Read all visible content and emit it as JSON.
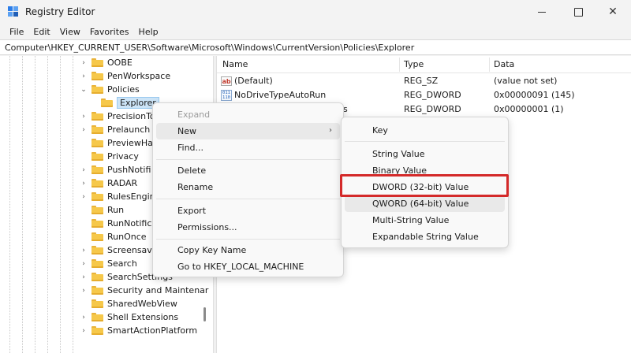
{
  "window": {
    "title": "Registry Editor",
    "controls": {
      "minimize": "minimize",
      "maximize": "maximize",
      "close": "✕"
    }
  },
  "menubar": [
    "File",
    "Edit",
    "View",
    "Favorites",
    "Help"
  ],
  "address": "Computer\\HKEY_CURRENT_USER\\Software\\Microsoft\\Windows\\CurrentVersion\\Policies\\Explorer",
  "tree": [
    {
      "label": "OOBE",
      "chevron": "›"
    },
    {
      "label": "PenWorkspace",
      "chevron": "›"
    },
    {
      "label": "Policies",
      "chevron": "⌄"
    },
    {
      "label": "Explorer",
      "chevron": ""
    },
    {
      "label": "PrecisionTo",
      "chevron": "›"
    },
    {
      "label": "Prelaunch",
      "chevron": "›"
    },
    {
      "label": "PreviewHa",
      "chevron": ""
    },
    {
      "label": "Privacy",
      "chevron": ""
    },
    {
      "label": "PushNotifi",
      "chevron": "›"
    },
    {
      "label": "RADAR",
      "chevron": "›"
    },
    {
      "label": "RulesEngin",
      "chevron": "›"
    },
    {
      "label": "Run",
      "chevron": ""
    },
    {
      "label": "RunNotific",
      "chevron": ""
    },
    {
      "label": "RunOnce",
      "chevron": ""
    },
    {
      "label": "Screensave",
      "chevron": "›"
    },
    {
      "label": "Search",
      "chevron": "›"
    },
    {
      "label": "SearchSettings",
      "chevron": "›"
    },
    {
      "label": "Security and Maintenar",
      "chevron": "›"
    },
    {
      "label": "SharedWebView",
      "chevron": ""
    },
    {
      "label": "Shell Extensions",
      "chevron": "›"
    },
    {
      "label": "SmartActionPlatform",
      "chevron": "›"
    }
  ],
  "list": {
    "headers": {
      "name": "Name",
      "type": "Type",
      "data": "Data"
    },
    "rows": [
      {
        "icon": "ab",
        "name": "(Default)",
        "type": "REG_SZ",
        "data": "(value not set)"
      },
      {
        "icon": "011\n110",
        "name": "NoDriveTypeAutoRun",
        "type": "REG_DWORD",
        "data": "0x00000091 (145)"
      },
      {
        "icon": "",
        "name": "s",
        "type": "REG_DWORD",
        "data": "0x00000001 (1)"
      }
    ]
  },
  "context_menu": {
    "items": [
      {
        "label": "Expand",
        "disabled": true
      },
      {
        "label": "New",
        "arrow": "›",
        "hover": true
      },
      {
        "label": "Find..."
      },
      {
        "label": "Delete"
      },
      {
        "label": "Rename"
      },
      {
        "label": "Export"
      },
      {
        "label": "Permissions..."
      },
      {
        "label": "Copy Key Name"
      },
      {
        "label": "Go to HKEY_LOCAL_MACHINE"
      }
    ]
  },
  "submenu": {
    "items": [
      {
        "label": "Key"
      },
      {
        "label": "String Value"
      },
      {
        "label": "Binary Value"
      },
      {
        "label": "DWORD (32-bit) Value",
        "highlighted": true
      },
      {
        "label": "QWORD (64-bit) Value"
      },
      {
        "label": "Multi-String Value"
      },
      {
        "label": "Expandable String Value"
      }
    ]
  },
  "colors": {
    "highlight_border": "#d42a2a",
    "selected_bg": "#cce4f7",
    "folder": "#f6c84a"
  }
}
